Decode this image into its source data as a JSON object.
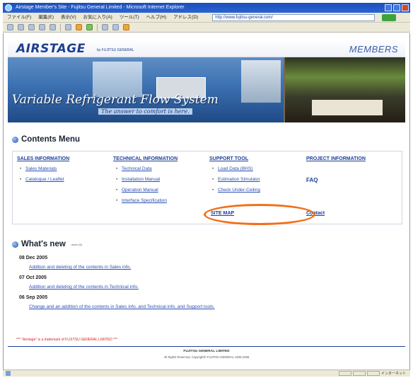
{
  "browser": {
    "title": "Airstage Member's Site - Fujitsu General Limited - Microsoft Internet Explorer",
    "menu": [
      "ファイル(F)",
      "編集(E)",
      "表示(V)",
      "お気に入り(A)",
      "ツール(T)",
      "ヘルプ(H)"
    ],
    "address_label": "アドレス(D)",
    "address": "http://www.fujitsu-general.com/",
    "go_label": "移動",
    "status_zone": "インターネット"
  },
  "header": {
    "logo": "AIRSTAGE",
    "logo_sub": "by FUJITSU GENERAL",
    "members": "MEMBERS"
  },
  "banner": {
    "title": "Variable Refrigerant Flow System",
    "tagline": "The answer to comfort is here."
  },
  "contents_menu": {
    "title": "Contents Menu",
    "sales": {
      "heading": "SALES INFORMATION",
      "items": [
        "Sales Materials",
        "Catalogue / Leaflet"
      ]
    },
    "technical": {
      "heading": "TECHNICAL INFORMATION",
      "items": [
        "Technical Data",
        "Installation Manual",
        "Operation Manual",
        "Interface Specification"
      ]
    },
    "support": {
      "heading": "SUPPORT TOOL",
      "items": [
        "Load Data (BHS)",
        "Estimation Simulator",
        "Check Under-Ceiling"
      ]
    },
    "project": {
      "heading": "PROJECT INFORMATION",
      "faq": "FAQ"
    },
    "site_map": "SITE MAP",
    "contact": "Contact"
  },
  "whats_new": {
    "title": "What's new",
    "small": "more (3)",
    "entries": [
      {
        "date": "08 Dec 2005",
        "text": "Addition and deleting of the contents in Sales info."
      },
      {
        "date": "07 Oct 2005",
        "text": "Addition and deleting of the contents in Technical info."
      },
      {
        "date": "06 Sep 2005",
        "text": "Change and an addition of the contents in Sales info. and Technical info. and Support tools."
      }
    ]
  },
  "footer": {
    "trademark": "*** \"Airstage\" is a trademark of FUJITSU GENERAL LIMITED ***",
    "company": "FUJITSU GENERAL LIMITED",
    "copyright": "All Rights Reserved, Copyright© FUJITSU GENERAL 2005-2006"
  },
  "colors": {
    "link": "#2b4fb3",
    "heading": "#1b3f9a",
    "highlight": "#f0701c"
  }
}
